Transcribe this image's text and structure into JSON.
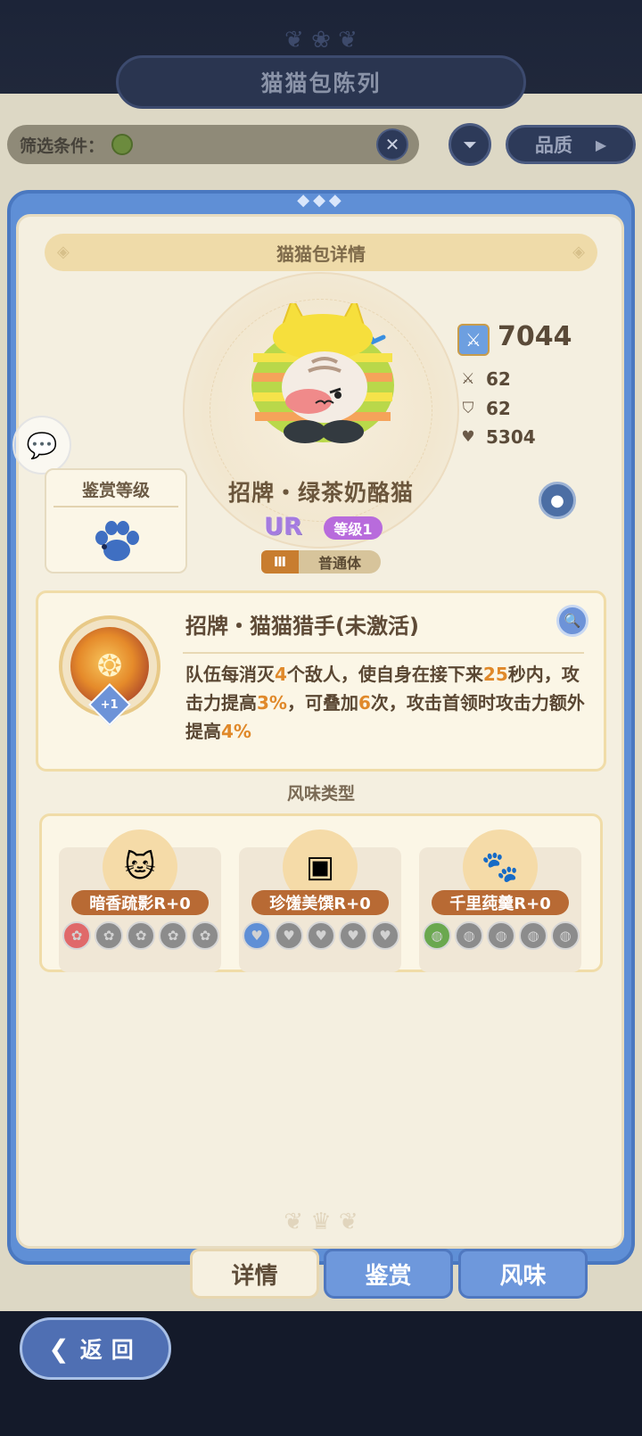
{
  "header": {
    "title": "猫猫包陈列"
  },
  "filter": {
    "label": "筛选条件：",
    "clear_icon": "close-icon",
    "filter_icon": "filter-icon",
    "quality_label": "品质"
  },
  "detail": {
    "panel_title": "猫猫包详情",
    "character_name": "招牌・绿茶奶酪猫",
    "rarity": "UR",
    "level": "等级1",
    "tier": "Ⅲ",
    "body_type": "普通体",
    "power": "7044",
    "attack": "62",
    "defense": "62",
    "hp": "5304",
    "appraise_title": "鉴赏等级"
  },
  "skill": {
    "title": "招牌・猫猫猎手(未激活)",
    "badge": "+1",
    "desc_parts": [
      "队伍每消灭",
      "4",
      "个敌人，使自身在接下来",
      "25",
      "秒内，攻击力提高",
      "3%",
      "，可叠加",
      "6",
      "次，攻击首领时攻击力额外提高",
      "4%"
    ]
  },
  "flavor": {
    "heading": "风味类型",
    "cards": [
      {
        "label": "暗香疏影R+0",
        "orb_icon": "cat-face-icon",
        "slot_icon": "flower-icon",
        "slot_color": "#e0696a"
      },
      {
        "label": "珍馐美馔R+0",
        "orb_icon": "bread-icon",
        "slot_icon": "heart-icon",
        "slot_color": "#5f8fd6"
      },
      {
        "label": "千里莼羹R+0",
        "orb_icon": "paw-icon",
        "slot_icon": "yarn-icon",
        "slot_color": "#6aa84f"
      }
    ]
  },
  "tabs": {
    "details": "详情",
    "appraise": "鉴赏",
    "flavor": "风味"
  },
  "back": {
    "label": "返回"
  },
  "colors": {
    "accent_blue": "#5f8fd6",
    "highlight_orange": "#e0892a",
    "panel_cream": "#f4efe0"
  }
}
